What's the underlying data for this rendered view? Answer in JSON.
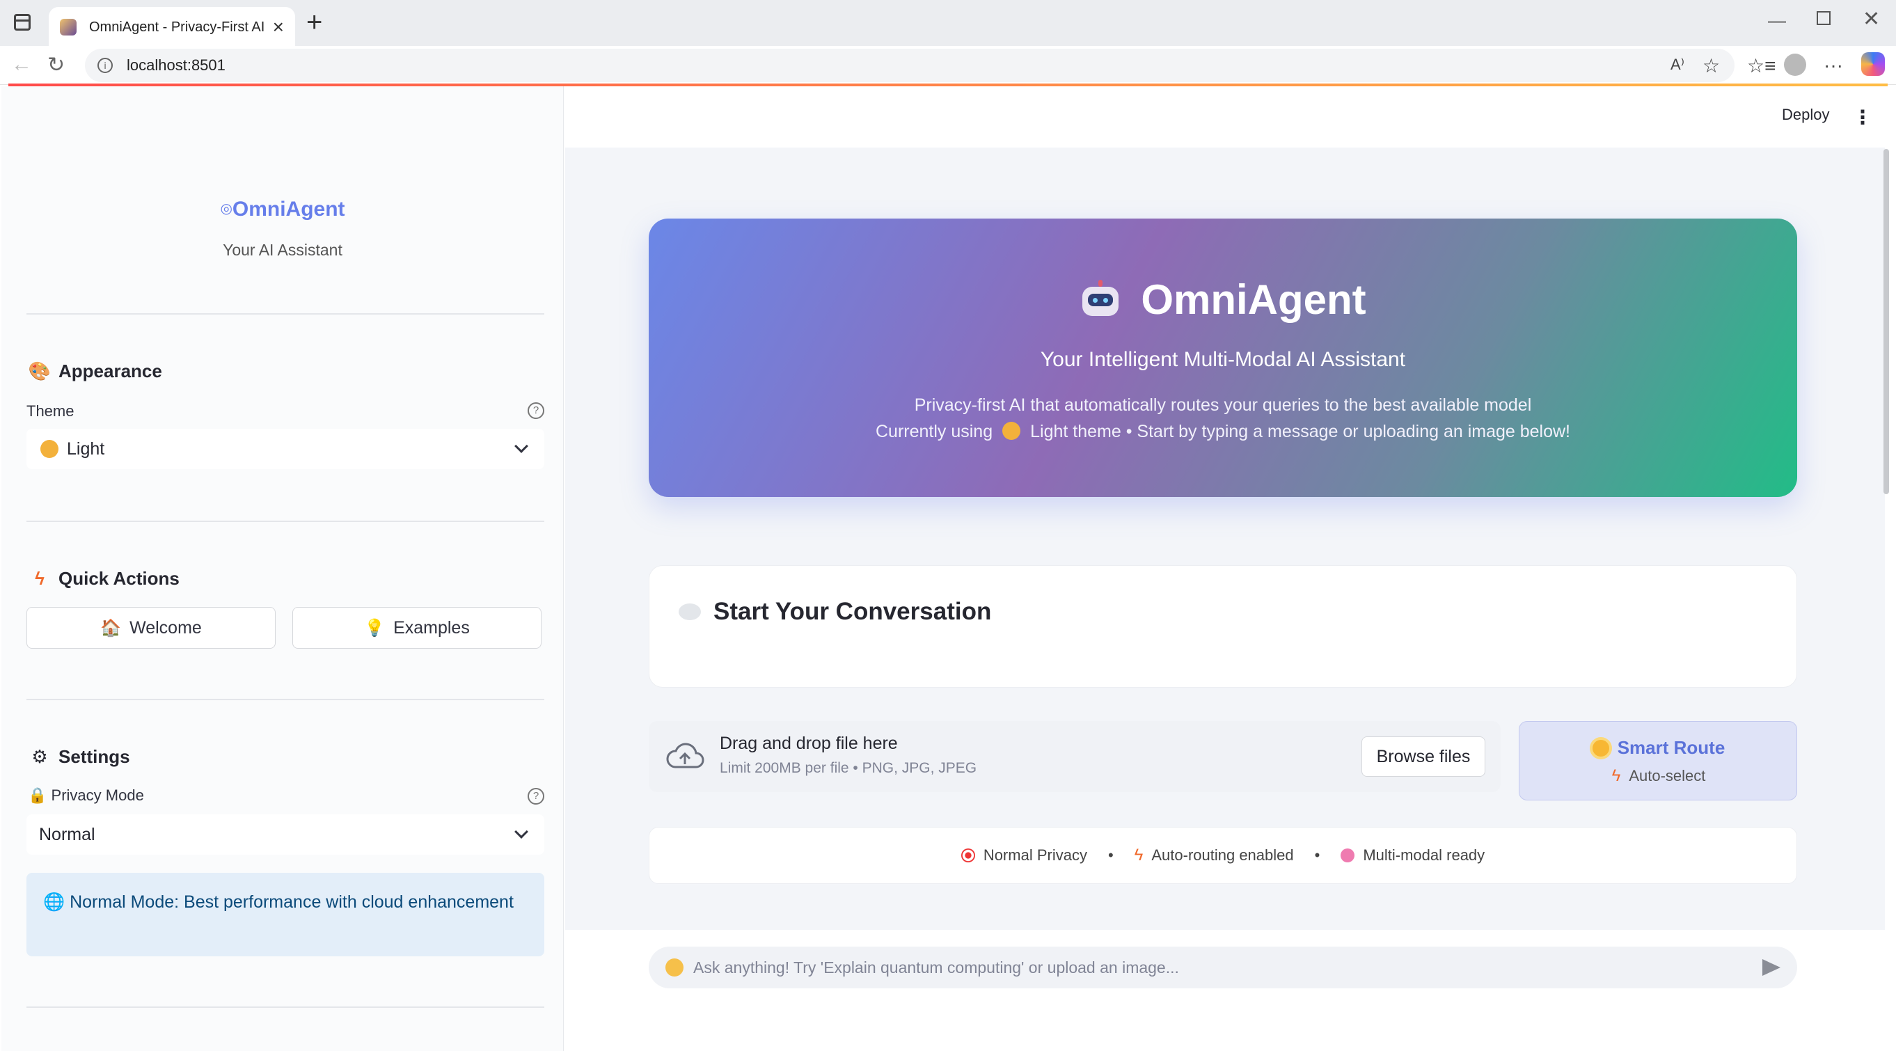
{
  "browser": {
    "tab_title": "OmniAgent - Privacy-First AI Assi",
    "url": "localhost:8501"
  },
  "sidebar": {
    "brand_title": "OmniAgent",
    "brand_subtitle": "Your AI Assistant",
    "appearance": {
      "heading": "Appearance",
      "theme_label": "Theme",
      "theme_value": "Light"
    },
    "quick_actions": {
      "heading": "Quick Actions",
      "welcome_label": "Welcome",
      "examples_label": "Examples"
    },
    "settings": {
      "heading": "Settings",
      "privacy_label": "Privacy Mode",
      "privacy_value": "Normal",
      "info_text": "Normal Mode: Best performance with cloud enhancement"
    }
  },
  "header": {
    "deploy_label": "Deploy",
    "menu_icon": "kebab-menu-icon"
  },
  "hero": {
    "title": "OmniAgent",
    "subtitle": "Your Intelligent Multi-Modal AI Assistant",
    "line1": "Privacy-first AI that automatically routes your queries to the best available model",
    "line2_prefix": "Currently using",
    "line2_suffix": "Light theme • Start by typing a message or uploading an image below!"
  },
  "conversation": {
    "title": "Start Your Conversation"
  },
  "uploader": {
    "title": "Drag and drop file here",
    "limit": "Limit 200MB per file • PNG, JPG, JPEG",
    "browse_label": "Browse files"
  },
  "route": {
    "title": "Smart Route",
    "subtitle": "Auto-select"
  },
  "status": {
    "privacy": "Normal Privacy",
    "routing": "Auto-routing enabled",
    "multimodal": "Multi-modal ready",
    "separator": "•"
  },
  "chat": {
    "placeholder": "Ask anything! Try 'Explain quantum computing' or upload an image..."
  },
  "colors": {
    "accent": "#667eea",
    "hero_start": "#6b87e7",
    "hero_end": "#22bc87",
    "info_bg": "#e3eef9"
  }
}
